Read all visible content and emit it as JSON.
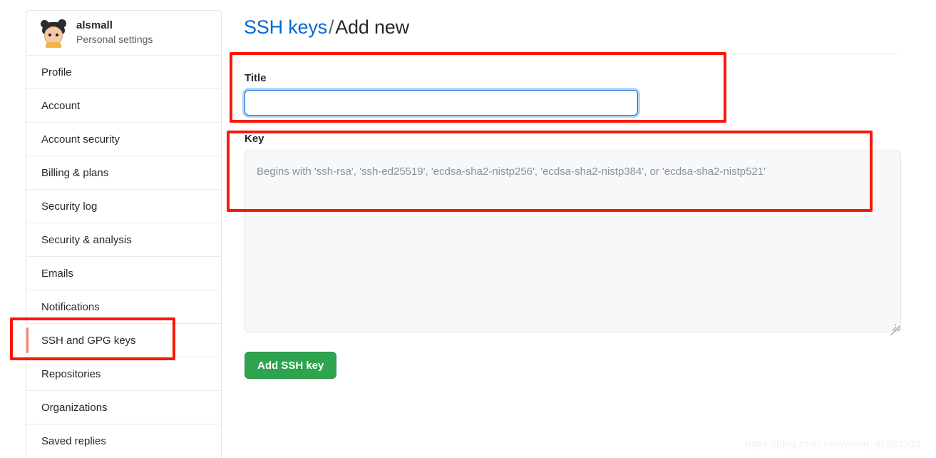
{
  "sidebar": {
    "profile": {
      "avatar_icon": "user-avatar-cartoon",
      "username": "alsmall",
      "subtitle": "Personal settings"
    },
    "items": [
      {
        "label": "Profile",
        "active": false
      },
      {
        "label": "Account",
        "active": false
      },
      {
        "label": "Account security",
        "active": false
      },
      {
        "label": "Billing & plans",
        "active": false
      },
      {
        "label": "Security log",
        "active": false
      },
      {
        "label": "Security & analysis",
        "active": false
      },
      {
        "label": "Emails",
        "active": false
      },
      {
        "label": "Notifications",
        "active": false
      },
      {
        "label": "SSH and GPG keys",
        "active": true
      },
      {
        "label": "Repositories",
        "active": false
      },
      {
        "label": "Organizations",
        "active": false
      },
      {
        "label": "Saved replies",
        "active": false
      }
    ]
  },
  "main": {
    "title": {
      "link_text": "SSH keys",
      "separator": "/",
      "current_text": "Add new"
    },
    "form": {
      "title_field": {
        "label": "Title",
        "value": "",
        "placeholder": "",
        "focused": true
      },
      "key_field": {
        "label": "Key",
        "value": "",
        "placeholder": "Begins with 'ssh-rsa', 'ssh-ed25519', 'ecdsa-sha2-nistp256', 'ecdsa-sha2-nistp384', or 'ecdsa-sha2-nistp521'"
      },
      "submit_label": "Add SSH key"
    }
  },
  "annotations": {
    "color": "#fb1708",
    "boxes": [
      {
        "name": "sidebar-ssh-and-gpg-keys"
      },
      {
        "name": "title-field"
      },
      {
        "name": "key-field"
      }
    ]
  },
  "watermark": {
    "text": "https://blog.csdn.net/weixin_45583303"
  },
  "colors": {
    "accent_link": "#0366d6",
    "active_bar": "#f9826c",
    "submit_green": "#2ea44f",
    "annotation_red": "#fb1708"
  }
}
